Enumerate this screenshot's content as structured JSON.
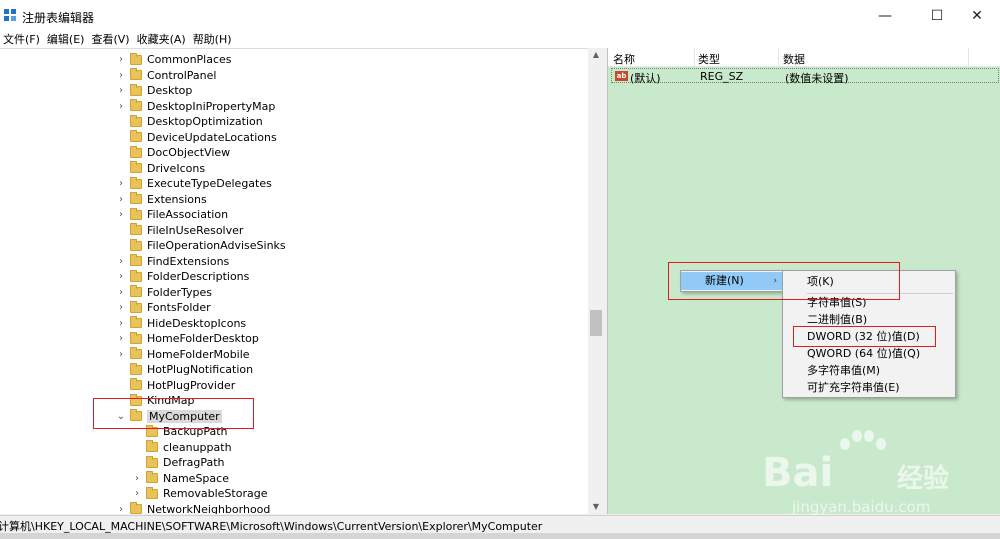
{
  "window": {
    "title": "注册表编辑器",
    "minimize": "—",
    "maximize": "☐",
    "close": "✕"
  },
  "menu": [
    "文件(F)",
    "编辑(E)",
    "查看(V)",
    "收藏夹(A)",
    "帮助(H)"
  ],
  "tree": [
    {
      "label": "CommonPlaces",
      "indent": 1,
      "expandable": true
    },
    {
      "label": "ControlPanel",
      "indent": 1,
      "expandable": true
    },
    {
      "label": "Desktop",
      "indent": 1,
      "expandable": true
    },
    {
      "label": "DesktopIniPropertyMap",
      "indent": 1,
      "expandable": true
    },
    {
      "label": "DesktopOptimization",
      "indent": 1,
      "expandable": false
    },
    {
      "label": "DeviceUpdateLocations",
      "indent": 1,
      "expandable": false
    },
    {
      "label": "DocObjectView",
      "indent": 1,
      "expandable": false
    },
    {
      "label": "DriveIcons",
      "indent": 1,
      "expandable": false
    },
    {
      "label": "ExecuteTypeDelegates",
      "indent": 1,
      "expandable": true
    },
    {
      "label": "Extensions",
      "indent": 1,
      "expandable": true
    },
    {
      "label": "FileAssociation",
      "indent": 1,
      "expandable": true
    },
    {
      "label": "FileInUseResolver",
      "indent": 1,
      "expandable": false
    },
    {
      "label": "FileOperationAdviseSinks",
      "indent": 1,
      "expandable": false
    },
    {
      "label": "FindExtensions",
      "indent": 1,
      "expandable": true
    },
    {
      "label": "FolderDescriptions",
      "indent": 1,
      "expandable": true
    },
    {
      "label": "FolderTypes",
      "indent": 1,
      "expandable": true
    },
    {
      "label": "FontsFolder",
      "indent": 1,
      "expandable": true
    },
    {
      "label": "HideDesktopIcons",
      "indent": 1,
      "expandable": true
    },
    {
      "label": "HomeFolderDesktop",
      "indent": 1,
      "expandable": true
    },
    {
      "label": "HomeFolderMobile",
      "indent": 1,
      "expandable": true
    },
    {
      "label": "HotPlugNotification",
      "indent": 1,
      "expandable": false
    },
    {
      "label": "HotPlugProvider",
      "indent": 1,
      "expandable": false
    },
    {
      "label": "KindMap",
      "indent": 1,
      "expandable": false
    },
    {
      "label": "MyComputer",
      "indent": 1,
      "expandable": true,
      "expanded": true,
      "selected": true
    },
    {
      "label": "BackupPath",
      "indent": 2,
      "expandable": false
    },
    {
      "label": "cleanuppath",
      "indent": 2,
      "expandable": false
    },
    {
      "label": "DefragPath",
      "indent": 2,
      "expandable": false
    },
    {
      "label": "NameSpace",
      "indent": 2,
      "expandable": true
    },
    {
      "label": "RemovableStorage",
      "indent": 2,
      "expandable": true
    },
    {
      "label": "NetworkNeighborhood",
      "indent": 1,
      "expandable": true
    }
  ],
  "columns": {
    "name": "名称",
    "type": "类型",
    "data": "数据"
  },
  "values": [
    {
      "name": "(默认)",
      "type": "REG_SZ",
      "data": "(数值未设置)",
      "icon": "ab"
    }
  ],
  "context_menu": {
    "new_label": "新建(N)",
    "submenu": [
      "项(K)",
      "字符串值(S)",
      "二进制值(B)",
      "DWORD (32 位)值(D)",
      "QWORD (64 位)值(Q)",
      "多字符串值(M)",
      "可扩充字符串值(E)"
    ]
  },
  "status_path": "计算机\\HKEY_LOCAL_MACHINE\\SOFTWARE\\Microsoft\\Windows\\CurrentVersion\\Explorer\\MyComputer",
  "watermark": {
    "brand": "Bai",
    "cn": "经验",
    "url": "jingyan.baidu.com",
    "logo": "baidu-paw-icon"
  },
  "colors": {
    "pane_bg": "#c8e9cb",
    "highlight": "#91c9f7",
    "annotation": "#e21c1c",
    "folder": "#e9c25a"
  }
}
